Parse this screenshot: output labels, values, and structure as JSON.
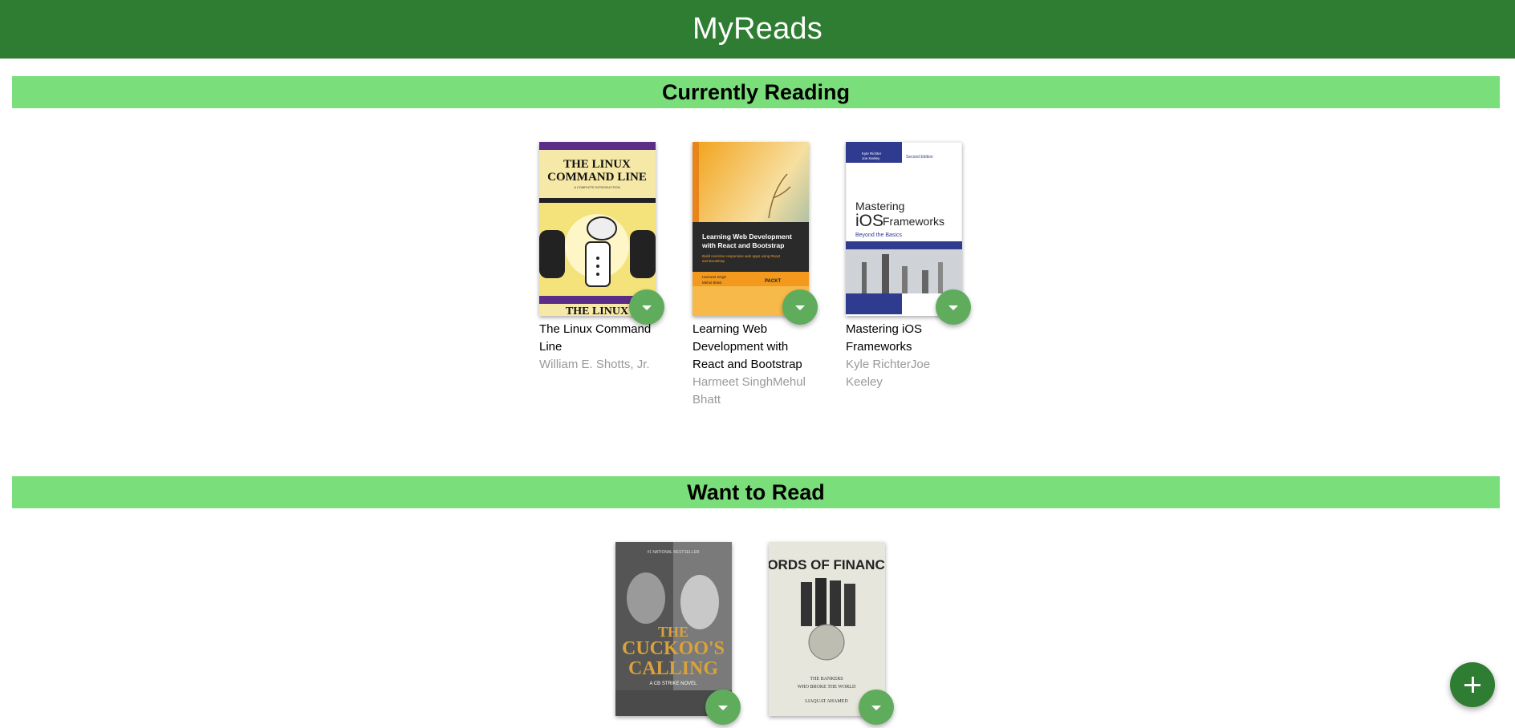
{
  "app": {
    "title": "MyReads"
  },
  "shelves": [
    {
      "title": "Currently Reading",
      "books": [
        {
          "title": "The Linux Command Line",
          "authors": "William E. Shotts, Jr.",
          "cover_icon": "linux-command-line-cover",
          "cover_text": [
            "THE LINUX",
            "COMMAND LINE",
            "A COMPLETE INTRODUCTION",
            "THE LINUX"
          ]
        },
        {
          "title": "Learning Web Development with React and Bootstrap",
          "authors": "Harmeet SinghMehul Bhatt",
          "cover_icon": "react-bootstrap-cover",
          "cover_text": [
            "Learning Web Development",
            "with React and Bootstrap",
            "Build real-time responsive web apps using React",
            "and Bootstrap",
            "Harmeet Singh",
            "Mehul Bhatt",
            "PACKT"
          ]
        },
        {
          "title": "Mastering iOS Frameworks",
          "authors": "Kyle RichterJoe Keeley",
          "cover_icon": "ios-frameworks-cover",
          "cover_text": [
            "Kyle Richter",
            "Joe Keeley",
            "Second Edition",
            "Mastering",
            "iOS",
            "Frameworks",
            "Beyond the Basics"
          ]
        }
      ]
    },
    {
      "title": "Want to Read",
      "books": [
        {
          "title": "The Cuckoo's Calling",
          "authors": "",
          "cover_icon": "cuckoos-calling-cover",
          "cover_text": [
            "#1 NATIONAL BESTSELLER",
            "THE",
            "CUCKOO'S",
            "CALLING",
            "A CB STRIKE NOVEL"
          ]
        },
        {
          "title": "Lords of Finance",
          "authors": "",
          "cover_icon": "lords-of-finance-cover",
          "cover_text": [
            "LORDS OF FINANCE",
            "THE BANKERS",
            "WHO BROKE THE WORLD",
            "LIAQUAT AHAMED"
          ]
        }
      ]
    }
  ],
  "colors": {
    "header": "#2e7d32",
    "shelf_bar": "#7ade7a",
    "changer": "#60ac5d",
    "author": "#999999"
  },
  "icons": {
    "shelf_changer": "chevron-down-icon",
    "add": "plus-icon"
  }
}
